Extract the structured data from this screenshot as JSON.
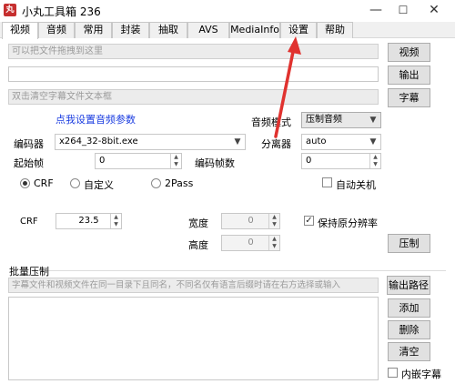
{
  "window": {
    "title": "小丸工具箱 236",
    "minimize": "—",
    "maximize": "☐",
    "close": "✕"
  },
  "tabs": [
    "视频",
    "音频",
    "常用",
    "封装",
    "抽取",
    "AVS",
    "MediaInfo",
    "设置",
    "帮助"
  ],
  "video": {
    "drop_placeholder": "可以把文件拖拽到这里",
    "output_value": "",
    "subtitle_placeholder": "双击清空字幕文件文本框",
    "btn_video": "视频",
    "btn_output": "输出",
    "btn_subtitle": "字幕",
    "audio_link": "点我设置音频参数",
    "audio_mode_label": "音频模式",
    "audio_mode_value": "压制音频",
    "encoder_label": "编码器",
    "encoder_value": "x264_32-8bit.exe",
    "separator_label": "分离器",
    "separator_value": "auto",
    "start_frame_label": "起始帧",
    "start_frame_value": "0",
    "encode_frames_label": "编码帧数",
    "encode_frames_value": "0",
    "mode_crf": "CRF",
    "mode_custom": "自定义",
    "mode_2pass": "2Pass",
    "auto_shutdown": "自动关机",
    "crf_label": "CRF",
    "crf_value": "23.5",
    "width_label": "宽度",
    "width_value": "0",
    "height_label": "高度",
    "height_value": "0",
    "keep_res": "保持原分辨率",
    "btn_encode": "压制"
  },
  "batch": {
    "title": "批量压制",
    "hint": "字幕文件和视频文件在同一目录下且同名，不同名仅有语言后缀时请在右方选择或输入",
    "btn_output_path": "输出路径",
    "btn_add": "添加",
    "btn_delete": "删除",
    "btn_clear": "清空",
    "embed_subs": "内嵌字幕"
  },
  "colors": {
    "accent_arrow": "#e0322f",
    "link": "#1a3ce0"
  }
}
